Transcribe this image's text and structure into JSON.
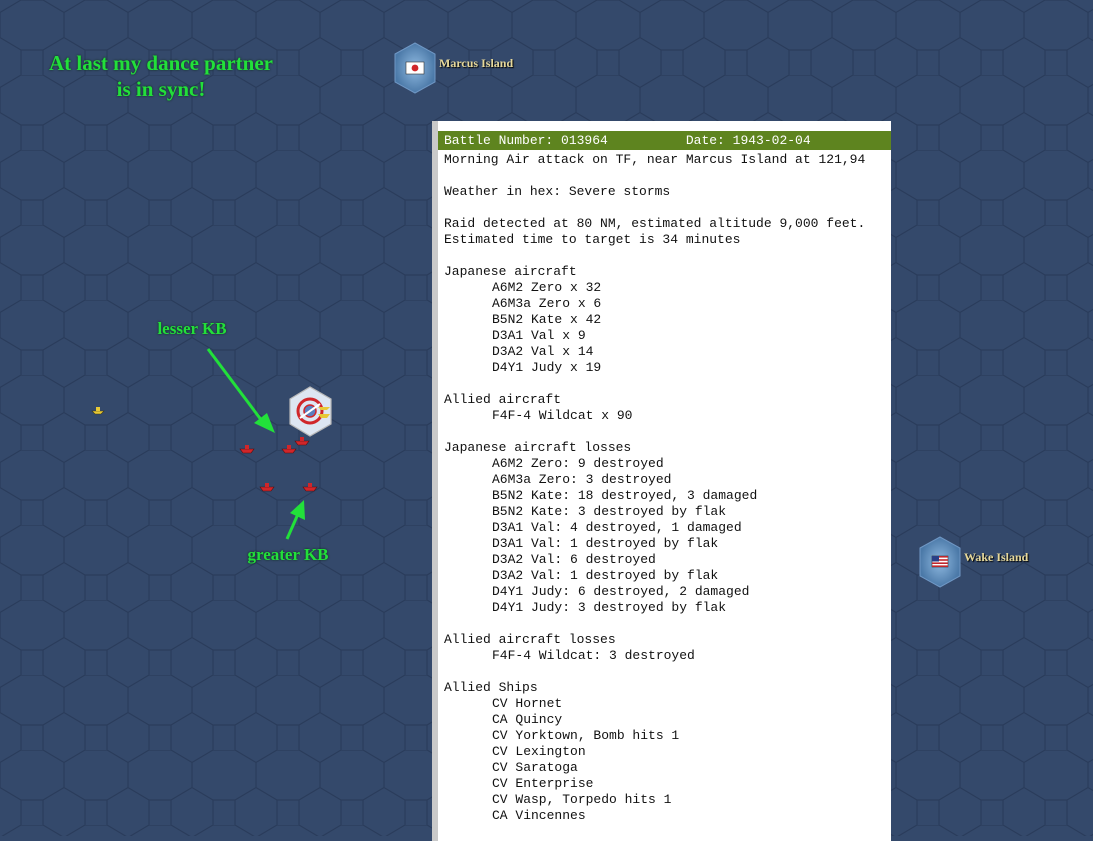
{
  "captions": {
    "main_line1": "At last my dance partner",
    "main_line2": "is in sync!",
    "lesser": "lesser KB",
    "greater": "greater KB"
  },
  "places": {
    "marcus": "Marcus Island",
    "wake": "Wake Island"
  },
  "colors": {
    "ocean": "#34496b",
    "hex_line": "#2a3c5b",
    "annotation": "#22e03a",
    "header": "#5e841f",
    "enemy_ship": "#d0262a"
  },
  "icons": {
    "marcus_flag": "japan-flag-icon",
    "wake_flag": "us-flag-icon",
    "selected_tf": "carrier-task-force-icon",
    "enemy_ships": "ship-icon"
  },
  "report": {
    "battle_label": "Battle Number: 013964",
    "date_label": "Date: 1943-02-04",
    "lines": [
      {
        "t": "Morning Air attack on TF, near Marcus Island at 121,94",
        "i": false
      },
      {
        "t": "",
        "i": false
      },
      {
        "t": "Weather in hex: Severe storms",
        "i": false
      },
      {
        "t": "",
        "i": false
      },
      {
        "t": "Raid detected at 80 NM, estimated altitude 9,000 feet.",
        "i": false
      },
      {
        "t": "Estimated time to target is 34 minutes",
        "i": false
      },
      {
        "t": "",
        "i": false
      },
      {
        "t": "Japanese aircraft",
        "i": false
      },
      {
        "t": "A6M2 Zero x 32",
        "i": true
      },
      {
        "t": "A6M3a Zero x 6",
        "i": true
      },
      {
        "t": "B5N2 Kate x 42",
        "i": true
      },
      {
        "t": "D3A1 Val x 9",
        "i": true
      },
      {
        "t": "D3A2 Val x 14",
        "i": true
      },
      {
        "t": "D4Y1 Judy x 19",
        "i": true
      },
      {
        "t": "",
        "i": false
      },
      {
        "t": "Allied aircraft",
        "i": false
      },
      {
        "t": "F4F-4 Wildcat x 90",
        "i": true
      },
      {
        "t": "",
        "i": false
      },
      {
        "t": "Japanese aircraft losses",
        "i": false
      },
      {
        "t": "A6M2 Zero: 9 destroyed",
        "i": true
      },
      {
        "t": "A6M3a Zero: 3 destroyed",
        "i": true
      },
      {
        "t": "B5N2 Kate: 18 destroyed, 3 damaged",
        "i": true
      },
      {
        "t": "B5N2 Kate: 3 destroyed by flak",
        "i": true
      },
      {
        "t": "D3A1 Val: 4 destroyed, 1 damaged",
        "i": true
      },
      {
        "t": "D3A1 Val: 1 destroyed by flak",
        "i": true
      },
      {
        "t": "D3A2 Val: 6 destroyed",
        "i": true
      },
      {
        "t": "D3A2 Val: 1 destroyed by flak",
        "i": true
      },
      {
        "t": "D4Y1 Judy: 6 destroyed, 2 damaged",
        "i": true
      },
      {
        "t": "D4Y1 Judy: 3 destroyed by flak",
        "i": true
      },
      {
        "t": "",
        "i": false
      },
      {
        "t": "Allied aircraft losses",
        "i": false
      },
      {
        "t": "F4F-4 Wildcat: 3 destroyed",
        "i": true
      },
      {
        "t": "",
        "i": false
      },
      {
        "t": "Allied Ships",
        "i": false
      },
      {
        "t": "CV Hornet",
        "i": true
      },
      {
        "t": "CA Quincy",
        "i": true
      },
      {
        "t": "CV Yorktown, Bomb hits 1",
        "i": true
      },
      {
        "t": "CV Lexington",
        "i": true
      },
      {
        "t": "CV Saratoga",
        "i": true
      },
      {
        "t": "CV Enterprise",
        "i": true
      },
      {
        "t": "CV Wasp, Torpedo hits 1",
        "i": true
      },
      {
        "t": "CA Vincennes",
        "i": true
      }
    ]
  }
}
